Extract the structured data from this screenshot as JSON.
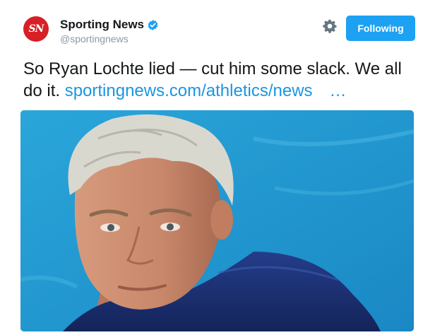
{
  "account": {
    "name": "Sporting News",
    "handle": "@sportingnews",
    "avatar_text": "SN",
    "verified": true
  },
  "actions": {
    "settings_icon": "gear-icon",
    "follow_label": "Following"
  },
  "tweet": {
    "text": "So Ryan Lochte lied — cut him some slack. We all do it.",
    "link": "sportingnews.com/athletics/news",
    "ellipsis": "…"
  },
  "colors": {
    "accent": "#1da1f2",
    "link": "#1b95e0",
    "avatar_bg": "#d81f26",
    "photo_bg": "#1f9ad0"
  }
}
